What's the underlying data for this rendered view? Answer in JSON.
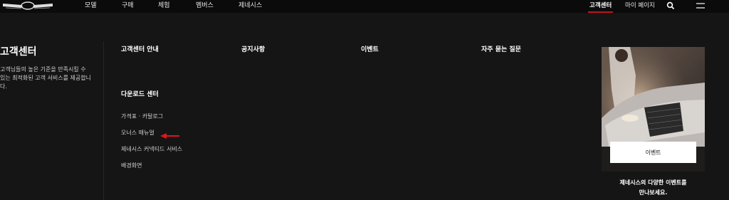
{
  "nav": {
    "items": [
      "모델",
      "구매",
      "체험",
      "멤버스",
      "제네시스"
    ],
    "right": {
      "customer_center": "고객센터",
      "mypage": "마이 페이지"
    },
    "accent_color": "#c0141b"
  },
  "side": {
    "title": "고객센터",
    "desc": "고객님들의 높은 기준을 만족시킬 수 있는 최적화된 고객 서비스를 제공합니다."
  },
  "columns": [
    "고객센터 안내",
    "공지사항",
    "이벤트",
    "자주 묻는 질문"
  ],
  "downloads": {
    "title": "다운로드 센터",
    "links": [
      "가격표 · 카탈로그",
      "오너스 매뉴얼",
      "제네시스 커넥티드 서비스",
      "배경화면"
    ]
  },
  "promo": {
    "button": "이벤트",
    "caption_line1": "제네시스의 다양한 이벤트를",
    "caption_line2": "만나보세요."
  },
  "icons": {
    "logo": "genesis-wing-logo",
    "search": "search-icon",
    "menu": "hamburger-menu-icon",
    "annotation": "red-arrow-icon"
  }
}
